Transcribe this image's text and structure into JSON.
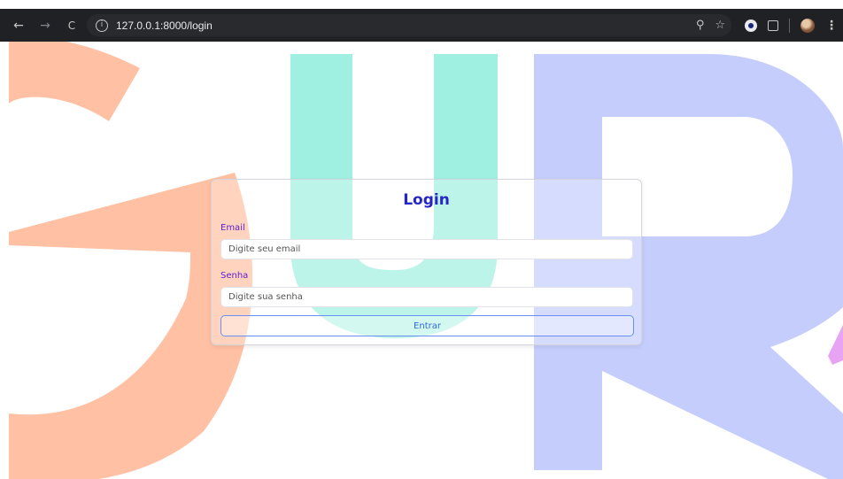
{
  "browser": {
    "url": "127.0.0.1:8000/login",
    "nav_icons": [
      "back-arrow-icon",
      "forward-arrow-icon",
      "reload-icon"
    ],
    "back_glyph": "←",
    "forward_glyph": "→",
    "reload_glyph": "C",
    "info_glyph": "i",
    "zoom_glyph": "⚲",
    "star_glyph": "☆",
    "menu_glyph": "⋮"
  },
  "login": {
    "title": "Login",
    "email_label": "Email",
    "email_placeholder": "Digite seu email",
    "password_label": "Senha",
    "password_placeholder": "Digite sua senha",
    "submit_label": "Entrar"
  },
  "colors": {
    "title": "#2626c7",
    "labels": "#5a1fd1",
    "button_border": "#6a8ff0",
    "bg_g": "#ffc0a3",
    "bg_u": "#9ff0e0",
    "bg_r": "#c5cdfd",
    "bg_pink": "#e8a3f5"
  }
}
